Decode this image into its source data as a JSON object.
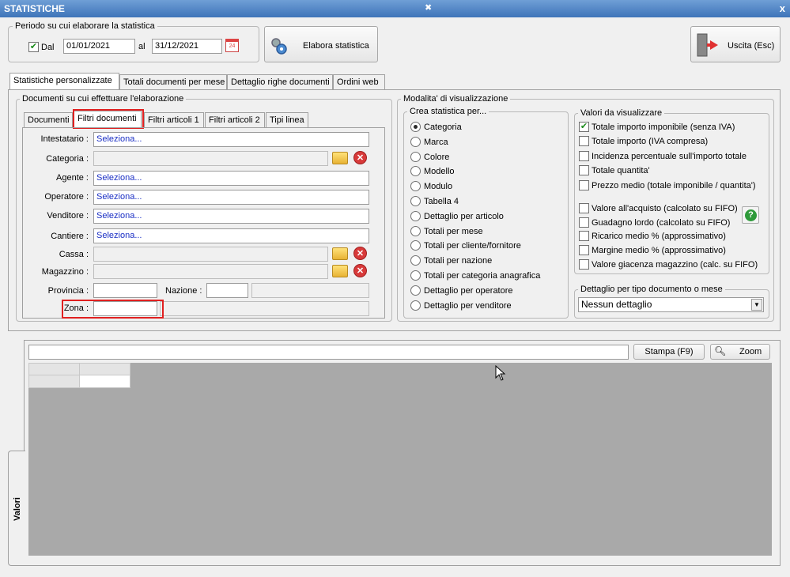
{
  "window": {
    "title": "STATISTICHE",
    "close": "x"
  },
  "periodo": {
    "legend": "Periodo su cui elaborare la statistica",
    "dal_label": "Dal",
    "dal_value": "01/01/2021",
    "al_label": "al",
    "al_value": "31/12/2021",
    "calendar_day": "24"
  },
  "toolbar": {
    "elabora_label": "Elabora statistica",
    "uscita_label": "Uscita (Esc)"
  },
  "main_tabs": [
    "Statistiche personalizzate",
    "Totali documenti per mese",
    "Dettaglio righe documenti",
    "Ordini web"
  ],
  "documenti": {
    "legend": "Documenti su cui effettuare l'elaborazione",
    "subtabs": [
      "Documenti",
      "Filtri documenti",
      "Filtri articoli 1",
      "Filtri articoli 2",
      "Tipi linea"
    ],
    "fields": {
      "intestatario": {
        "label": "Intestatario :",
        "value": "Seleziona..."
      },
      "categoria": {
        "label": "Categoria :",
        "value": ""
      },
      "agente": {
        "label": "Agente :",
        "value": "Seleziona..."
      },
      "operatore": {
        "label": "Operatore :",
        "value": "Seleziona..."
      },
      "venditore": {
        "label": "Venditore :",
        "value": "Seleziona..."
      },
      "cantiere": {
        "label": "Cantiere :",
        "value": "Seleziona..."
      },
      "cassa": {
        "label": "Cassa :",
        "value": ""
      },
      "magazzino": {
        "label": "Magazzino :",
        "value": ""
      },
      "provincia": {
        "label": "Provincia :",
        "value": ""
      },
      "nazione": {
        "label": "Nazione :",
        "value": ""
      },
      "zona": {
        "label": "Zona :",
        "value": ""
      }
    }
  },
  "modalita": {
    "legend": "Modalita' di visualizzazione",
    "crea": {
      "legend": "Crea statistica per...",
      "selected": "Categoria",
      "options": [
        "Categoria",
        "Marca",
        "Colore",
        "Modello",
        "Modulo",
        "Tabella 4",
        "Dettaglio per articolo",
        "Totali per mese",
        "Totali per cliente/fornitore",
        "Totali per nazione",
        "Totali per categoria anagrafica",
        "Dettaglio per operatore",
        "Dettaglio per venditore"
      ]
    },
    "valori": {
      "legend": "Valori da visualizzare",
      "items": [
        {
          "label": "Totale importo imponibile (senza IVA)",
          "checked": true
        },
        {
          "label": "Totale importo (IVA compresa)",
          "checked": false
        },
        {
          "label": "Incidenza percentuale sull'importo totale",
          "checked": false
        },
        {
          "label": "Totale quantita'",
          "checked": false
        },
        {
          "label": "Prezzo medio (totale imponibile / quantita')",
          "checked": false
        },
        {
          "label": "Valore all'acquisto (calcolato su FIFO)",
          "checked": false
        },
        {
          "label": "Guadagno lordo (calcolato su FIFO)",
          "checked": false
        },
        {
          "label": "Ricarico medio % (approssimativo)",
          "checked": false
        },
        {
          "label": "Margine medio % (approssimativo)",
          "checked": false
        },
        {
          "label": "Valore giacenza magazzino (calc. su FIFO)",
          "checked": false
        }
      ],
      "help": "?"
    },
    "dettaglio": {
      "legend": "Dettaglio per tipo documento o mese",
      "value": "Nessun dettaglio"
    }
  },
  "results": {
    "stampa_label": "Stampa (F9)",
    "zoom_label": "Zoom",
    "side_tab": "Valori",
    "search_value": ""
  }
}
